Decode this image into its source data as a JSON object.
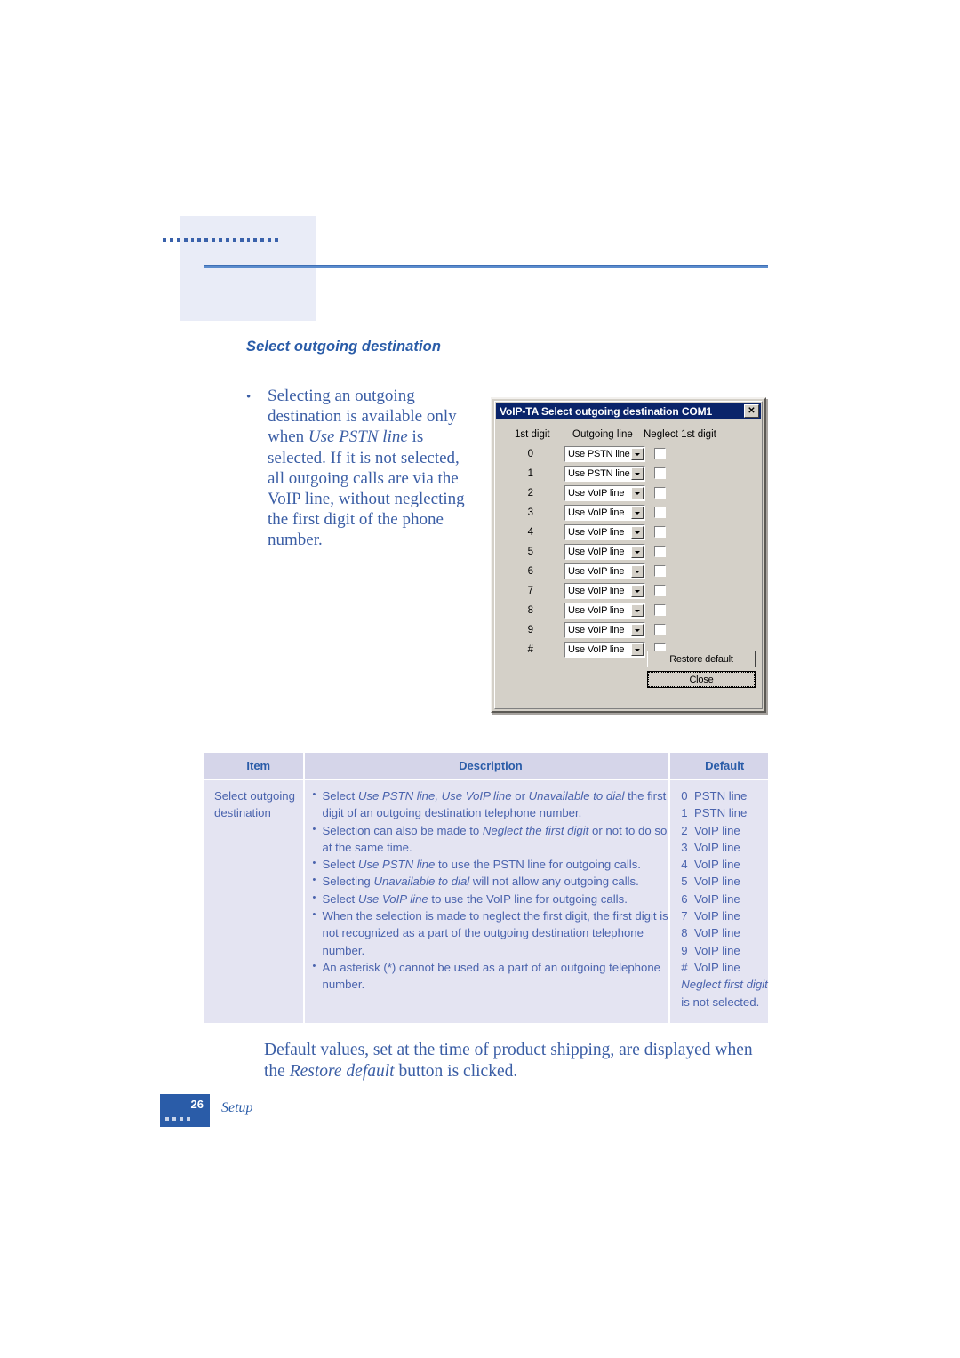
{
  "page": {
    "section_heading": "Select outgoing destination",
    "footer_page_number": "26",
    "footer_section_label": "Setup"
  },
  "intro_bullet": {
    "part1": "Selecting an outgoing destination is available only when ",
    "italic1": "Use PSTN line",
    "part2": " is selected. If it is not selected, all outgoing calls are via the VoIP line, without neglecting the first digit of the phone number."
  },
  "dialog": {
    "title": "VoIP-TA Select outgoing destination COM1",
    "close_icon_label": "✕",
    "headers": {
      "digit": "1st digit",
      "line": "Outgoing line",
      "neglect": "Neglect 1st digit"
    },
    "rows": [
      {
        "digit": "0",
        "line": "Use PSTN line",
        "neglect": false
      },
      {
        "digit": "1",
        "line": "Use PSTN line",
        "neglect": false
      },
      {
        "digit": "2",
        "line": "Use VoIP line",
        "neglect": false
      },
      {
        "digit": "3",
        "line": "Use VoIP line",
        "neglect": false
      },
      {
        "digit": "4",
        "line": "Use VoIP line",
        "neglect": false
      },
      {
        "digit": "5",
        "line": "Use VoIP line",
        "neglect": false
      },
      {
        "digit": "6",
        "line": "Use VoIP line",
        "neglect": false
      },
      {
        "digit": "7",
        "line": "Use VoIP line",
        "neglect": false
      },
      {
        "digit": "8",
        "line": "Use VoIP line",
        "neglect": false
      },
      {
        "digit": "9",
        "line": "Use VoIP line",
        "neglect": false
      },
      {
        "digit": "#",
        "line": "Use VoIP line",
        "neglect": false
      }
    ],
    "buttons": {
      "restore_default": "Restore default",
      "close": "Close"
    }
  },
  "spec_table": {
    "headers": [
      "Item",
      "Description",
      "Default"
    ],
    "item": "Select outgoing destination",
    "description_bullets": [
      "Select Use PSTN line, Use VoIP line or Unavailable to dial the first digit of an outgoing destination telephone number.",
      "Selection can also be made to Neglect the first digit or not to do so at the same time.",
      "Select Use PSTN line to use the PSTN line for outgoing calls.",
      "Selecting Unavailable to dial will not allow any outgoing calls.",
      "Select Use VoIP line to use the VoIP line for outgoing calls.",
      "When the selection is made to neglect the first digit, the first digit is not recognized as a part of the outgoing destination telephone number.",
      "An asterisk (*) cannot be used as a part of an outgoing telephone number."
    ],
    "defaults": [
      "0  PSTN line",
      "1  PSTN line",
      "2  VoIP line",
      "3  VoIP line",
      "4  VoIP line",
      "5  VoIP line",
      "6  VoIP line",
      "7  VoIP line",
      "8  VoIP line",
      "9  VoIP line",
      "#  VoIP line"
    ],
    "default_note_italic": "Neglect first digit",
    "default_note_rest": " is not selected."
  },
  "closing_paragraph": {
    "part1": "Default values, set at the time of product shipping, are displayed when the ",
    "italic1": "Restore default",
    "part2": " button is clicked."
  },
  "colors": {
    "brand_blue": "#2a5ca8",
    "body_text_blue": "#3b5ea5",
    "table_text_blue": "#4a63ad",
    "table_bg": "#e4e4f2",
    "table_header_bg": "#d5d5e9",
    "header_block_bg": "#e9ecf7",
    "dialog_titlebar": "#0a246a",
    "dialog_face": "#d4d0c8"
  }
}
